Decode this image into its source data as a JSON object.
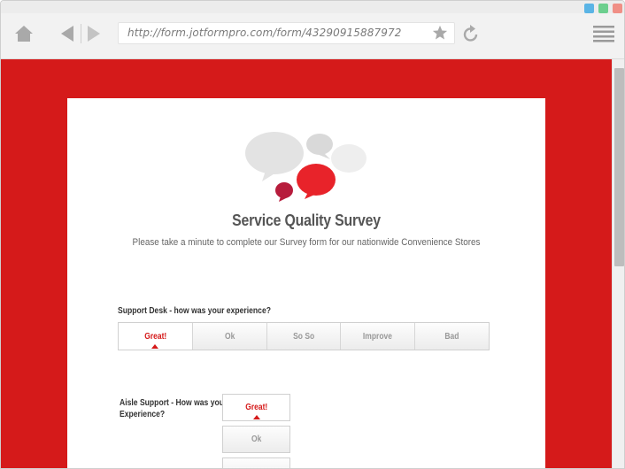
{
  "browser": {
    "url": "http://form.jotformpro.com/form/43290915887972",
    "window_dot_colors": [
      "#5ab4e5",
      "#6ccf8e",
      "#f08f86"
    ],
    "icons": [
      "home-icon",
      "back-icon",
      "forward-icon",
      "star-icon",
      "reload-icon",
      "menu-icon"
    ]
  },
  "page": {
    "background_color": "#d51a1a",
    "accent_color": "#d51a1a"
  },
  "form": {
    "title": "Service Quality Survey",
    "subtitle": "Please take a minute to complete our Survey form for our nationwide Convenience Stores",
    "questions": [
      {
        "label": "Support Desk - how was your experience?",
        "options": [
          "Great!",
          "Ok",
          "So So",
          "Improve",
          "Bad"
        ],
        "selected": "Great!"
      },
      {
        "label_line1": "Aisle Support - How was your",
        "label_line2": "Experience?",
        "options": [
          "Great!",
          "Ok"
        ],
        "selected": "Great!"
      }
    ]
  }
}
